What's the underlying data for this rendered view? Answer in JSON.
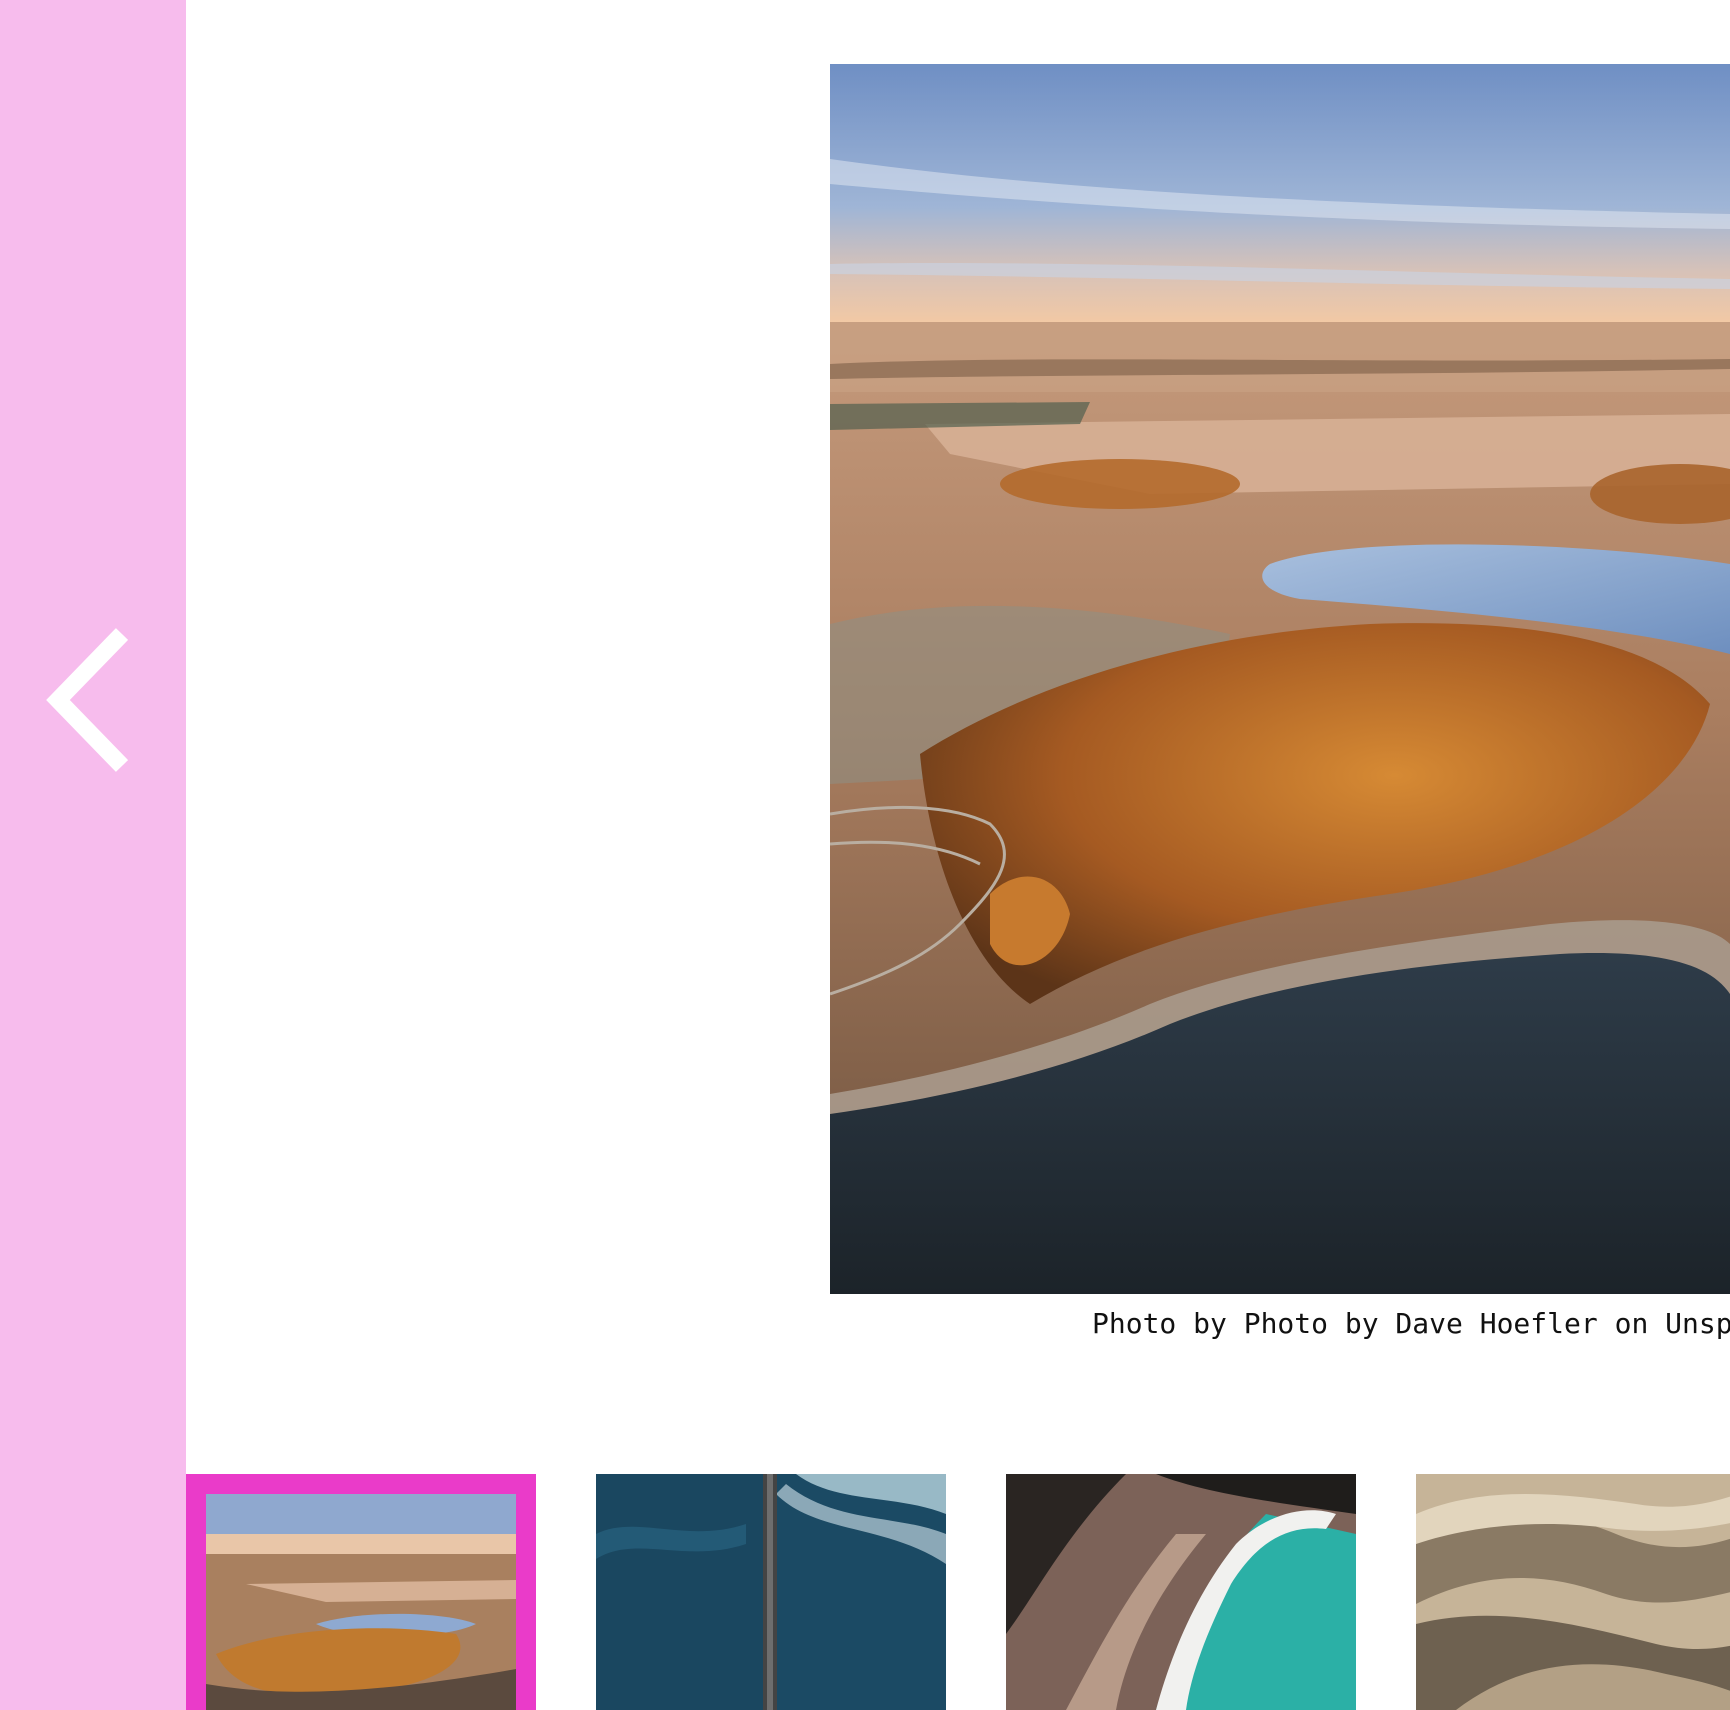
{
  "gallery": {
    "caption": "Photo by Photo by Dave Hoefler on Unsplash",
    "selected_index": 0,
    "thumbnails": [
      {
        "subject": "autumn farmland lake aerial",
        "selected": true
      },
      {
        "subject": "ocean pier aerial"
      },
      {
        "subject": "beach waves aerial"
      },
      {
        "subject": "sand dunes"
      }
    ]
  },
  "controls": {
    "prev_icon": "chevron-left-icon"
  },
  "colors": {
    "side_panel": "#f7bced",
    "selected_border": "#ea3bc9",
    "background": "#ffffff",
    "caption_text": "#111111"
  }
}
